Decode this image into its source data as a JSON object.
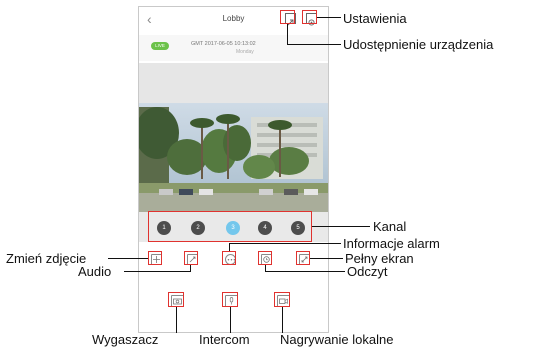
{
  "app": {
    "title": "Lobby",
    "back_glyph": "‹",
    "live_badge": "LIVE",
    "datetime": "GMT 2017-06-05 10:13:02",
    "weekday": "Monday",
    "channels": [
      "1",
      "2",
      "3",
      "4",
      "5"
    ],
    "active_channel": "3",
    "icons": {
      "header": [
        "share-icon",
        "settings-icon"
      ],
      "toolbar": [
        "screenshot-icon",
        "audio-icon",
        "alarm-info-icon",
        "playback-icon",
        "fullscreen-icon"
      ],
      "actions": [
        "camera-icon",
        "microphone-icon",
        "video-record-icon"
      ]
    }
  },
  "callouts": {
    "settings": "Ustawienia",
    "share_device": "Udostępnienie urządzenia",
    "channel": "Kanal",
    "alarm_info": "Informacje alarm",
    "change_photo": "Zmień zdjęcie",
    "fullscreen": "Pełny ekran",
    "audio": "Audio",
    "playback": "Odczyt",
    "screenshot": "Wygaszacz",
    "intercom": "Intercom",
    "local_recording": "Nagrywanie lokalne"
  },
  "colors": {
    "highlight": "#e0322f",
    "live": "#6cc24a",
    "active_channel": "#74c7ec",
    "channel": "#4d4d4d"
  }
}
